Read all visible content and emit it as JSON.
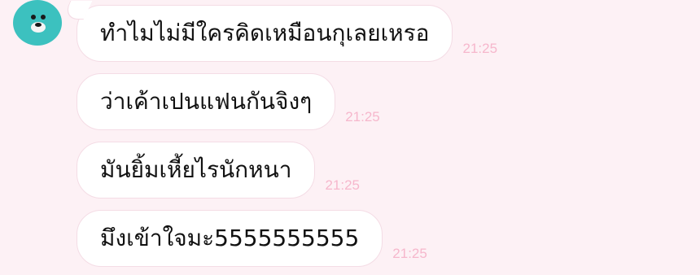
{
  "theme": {
    "background": "#fdf1f5",
    "avatar_color": "#3cc1bf",
    "bubble_color": "#ffffff",
    "time_color": "#f6b7cc"
  },
  "contact": {
    "avatar_icon": "bear-icon"
  },
  "messages": [
    {
      "text": "ทำไมไม่มีใครคิดเหมือนกุเลยเหรอ",
      "time": "21:25"
    },
    {
      "text": "ว่าเค้าเปนแฟนกันจิงๆ",
      "time": "21:25"
    },
    {
      "text": "มันยิ้มเหี้ยไรนักหนา",
      "time": "21:25"
    },
    {
      "text": "มึงเข้าใจมะ5555555555",
      "time": "21:25"
    }
  ]
}
